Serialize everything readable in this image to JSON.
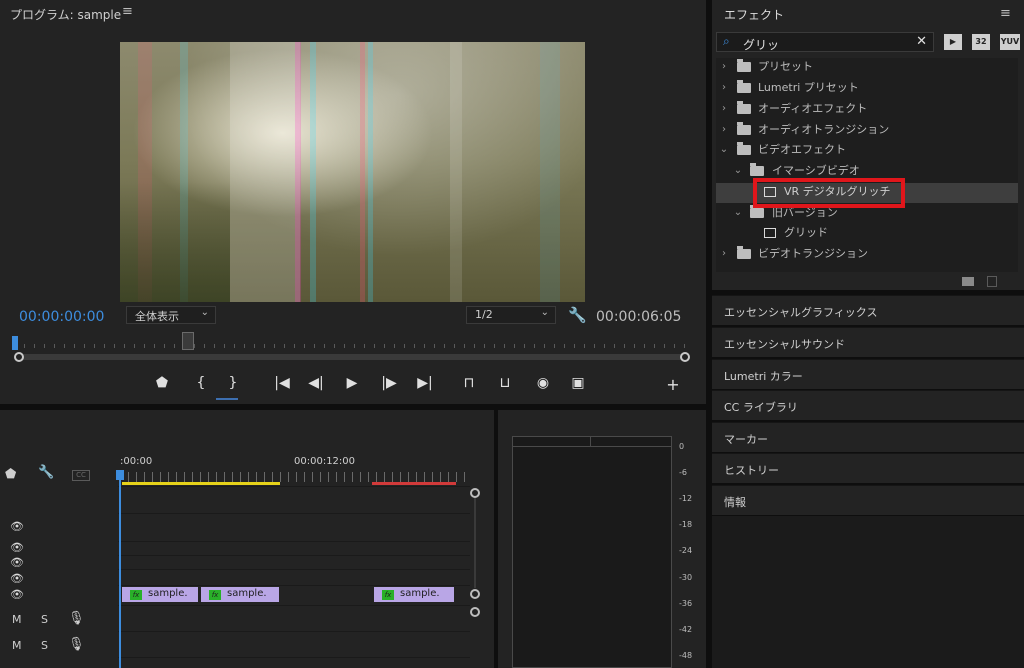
{
  "program_monitor": {
    "title": "プログラム: sample",
    "menu_icon": "hamburger-icon",
    "current_timecode": "00:00:00:00",
    "duration_timecode": "00:00:06:05",
    "zoom_value": "全体表示",
    "resolution_value": "1/2",
    "transport_icons": [
      "marker-icon",
      "in-point-icon",
      "out-point-icon",
      "go-to-in-icon",
      "step-back-icon",
      "play-icon",
      "step-forward-icon",
      "go-to-out-icon",
      "lift-icon",
      "extract-icon",
      "export-frame-icon",
      "comparison-view-icon",
      "add-button-icon"
    ]
  },
  "timeline": {
    "time_start": ":00:00",
    "time_mid": "00:00:12:00",
    "audio_labels": [
      "M",
      "S",
      "M",
      "S"
    ],
    "clips": [
      "sample.",
      "sample.",
      "sample."
    ],
    "fx_label": "fx"
  },
  "audio_meter": {
    "db_labels": [
      "0",
      "-6",
      "-12",
      "-18",
      "-24",
      "-30",
      "-36",
      "-42",
      "-48"
    ]
  },
  "effects_panel": {
    "title": "エフェクト",
    "search_value": "グリッ",
    "filter_labels": [
      "32",
      "YUV"
    ],
    "tree": [
      {
        "label": "プリセット",
        "level": 0,
        "kind": "folder-star",
        "expanded": false
      },
      {
        "label": "Lumetri プリセット",
        "level": 0,
        "kind": "folder-star",
        "expanded": false
      },
      {
        "label": "オーディオエフェクト",
        "level": 0,
        "kind": "folder",
        "expanded": false
      },
      {
        "label": "オーディオトランジション",
        "level": 0,
        "kind": "folder",
        "expanded": false
      },
      {
        "label": "ビデオエフェクト",
        "level": 0,
        "kind": "folder",
        "expanded": true
      },
      {
        "label": "イマーシブビデオ",
        "level": 1,
        "kind": "folder",
        "expanded": true
      },
      {
        "label": "VR デジタルグリッチ",
        "level": 2,
        "kind": "effect",
        "selected": true
      },
      {
        "label": "旧バージョン",
        "level": 1,
        "kind": "folder",
        "expanded": true
      },
      {
        "label": "グリッド",
        "level": 2,
        "kind": "effect"
      },
      {
        "label": "ビデオトランジション",
        "level": 0,
        "kind": "folder",
        "expanded": false
      }
    ]
  },
  "side_panels": [
    "エッセンシャルグラフィックス",
    "エッセンシャルサウンド",
    "Lumetri カラー",
    "CC ライブラリ",
    "マーカー",
    "ヒストリー",
    "情報"
  ],
  "colors": {
    "accent_blue": "#3d8dde",
    "highlight_red": "#e0161b",
    "clip_purple": "#b9a6e6",
    "fx_green": "#29b029",
    "workarea_yellow": "#e6d21a",
    "workarea_red": "#d13a3a"
  }
}
